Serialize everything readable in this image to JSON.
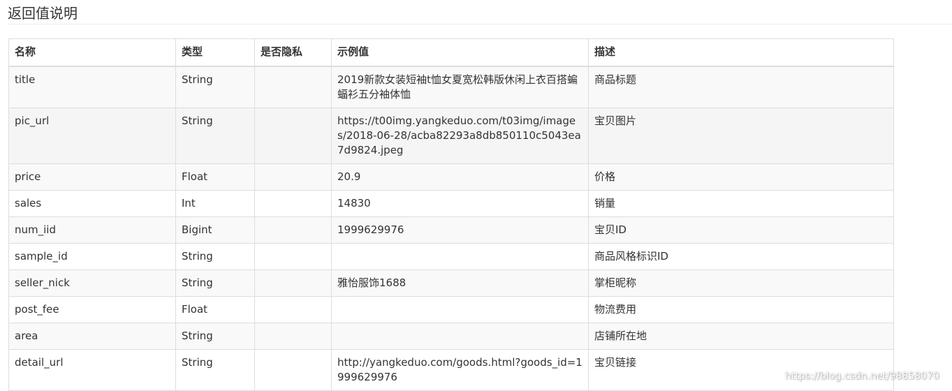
{
  "page": {
    "heading": "返回值说明"
  },
  "table": {
    "headers": [
      "名称",
      "类型",
      "是否隐私",
      "示例值",
      "描述"
    ],
    "rows": [
      [
        "title",
        "String",
        "",
        "2019新款女装短袖t恤女夏宽松韩版休闲上衣百搭蝙蝠衫五分袖体恤",
        "商品标题"
      ],
      [
        "pic_url",
        "String",
        "",
        "https://t00img.yangkeduo.com/t03img/images/2018-06-28/acba82293a8db850110c5043ea7d9824.jpeg",
        "宝贝图片"
      ],
      [
        "price",
        "Float",
        "",
        "20.9",
        "价格"
      ],
      [
        "sales",
        "Int",
        "",
        "14830",
        "销量"
      ],
      [
        "num_iid",
        "Bigint",
        "",
        "1999629976",
        "宝贝ID"
      ],
      [
        "sample_id",
        "String",
        "",
        "",
        "商品风格标识ID"
      ],
      [
        "seller_nick",
        "String",
        "",
        "雅怡服饰1688",
        "掌柜昵称"
      ],
      [
        "post_fee",
        "Float",
        "",
        "",
        "物流费用"
      ],
      [
        "area",
        "String",
        "",
        "",
        "店铺所在地"
      ],
      [
        "detail_url",
        "String",
        "",
        "http://yangkeduo.com/goods.html?goods_id=1999629976",
        "宝贝链接"
      ]
    ]
  },
  "watermark": {
    "text": "https://blog.csdn.net/98858070"
  },
  "colors": {
    "border": "#dddddd",
    "stripe": "#f9f9f9",
    "text": "#333333"
  }
}
